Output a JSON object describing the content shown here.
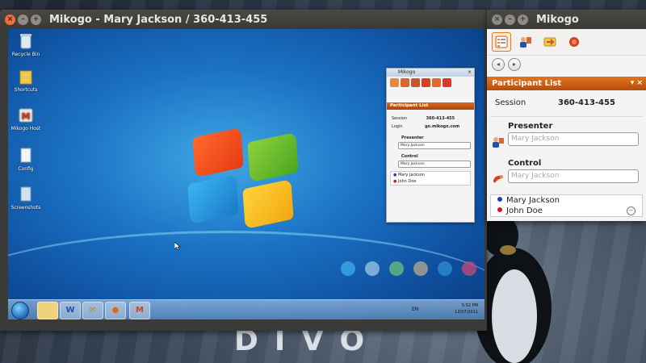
{
  "host": {
    "background_text": "DIVO",
    "accent": "#e07b22"
  },
  "viewer": {
    "title": "Mikogo - Mary Jackson / 360-413-455",
    "controls": {
      "close": "×",
      "minimize": "–",
      "maximize": "+"
    }
  },
  "remote_desktop": {
    "icons": [
      {
        "label": "Recycle Bin",
        "icon": "recycle-bin-icon"
      },
      {
        "label": "Shortcuts",
        "icon": "folder-icon"
      },
      {
        "label": "Mikogo Host",
        "icon": "mikogo-icon"
      },
      {
        "label": "Config",
        "icon": "document-icon"
      },
      {
        "label": "Screenshots",
        "icon": "document-icon"
      }
    ],
    "taskbar": {
      "items": [
        "W",
        "✉",
        "●",
        "M"
      ],
      "language": "EN",
      "time": "5:52 PM",
      "date": "12/07/2011"
    },
    "dot_colors": [
      "#3cb0e6",
      "#9fc7e6",
      "#6cc27a",
      "#b8a98a",
      "#2e8fd0",
      "#c84a76"
    ]
  },
  "remote_mikogo": {
    "title": "Mikogo",
    "header": "Participant List",
    "session_label": "Session",
    "session_value": "360-413-455",
    "login_label": "Login",
    "login_value": "go.mikogo.com",
    "presenter_label": "Presenter",
    "presenter_value": "Mary Jackson",
    "control_label": "Control",
    "control_value": "Mary Jackson",
    "participants": [
      {
        "name": "Mary Jackson",
        "color": "#1c3fc7"
      },
      {
        "name": "John Doe",
        "color": "#d01a1a"
      }
    ]
  },
  "panel": {
    "title": "Mikogo",
    "header": "Participant List",
    "header_controls": "▾ ×",
    "session_label": "Session",
    "session_value": "360-413-455",
    "presenter_label": "Presenter",
    "presenter_placeholder": "Mary Jackson",
    "control_label": "Control",
    "control_placeholder": "Mary Jackson",
    "participants": [
      {
        "name": "Mary Jackson",
        "color": "#1c3fc7"
      },
      {
        "name": "John Doe",
        "color": "#d01a1a"
      }
    ],
    "tools": [
      {
        "name": "participant-list-tool-icon",
        "color": "#e8883a"
      },
      {
        "name": "presenter-tool-icon",
        "color": "#d9692a"
      },
      {
        "name": "switch-presenter-tool-icon",
        "color": "#c8582a"
      },
      {
        "name": "remote-control-tool-icon",
        "color": "#d8401f"
      }
    ]
  }
}
